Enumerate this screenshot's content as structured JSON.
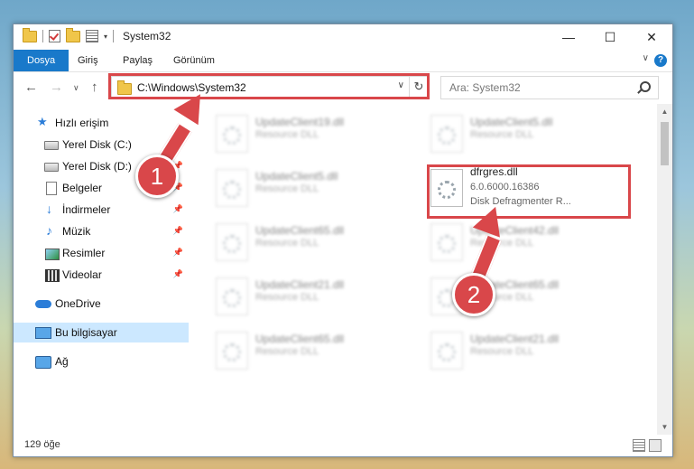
{
  "window": {
    "title": "System32",
    "controls": {
      "minimize": "—",
      "maximize": "☐",
      "close": "✕"
    }
  },
  "ribbon": {
    "tabs": [
      "Dosya",
      "Giriş",
      "Paylaş",
      "Görünüm"
    ],
    "help": "?"
  },
  "nav": {
    "back": "←",
    "forward": "→",
    "recent": "∨",
    "up": "↑",
    "address": "C:\\Windows\\System32",
    "refresh": "↻",
    "search_placeholder": "Ara: System32"
  },
  "sidebar": {
    "items": [
      {
        "label": "Hızlı erişim",
        "icon": "star-icon"
      },
      {
        "label": "Yerel Disk (C:)",
        "icon": "disk-icon",
        "pinned": true
      },
      {
        "label": "Yerel Disk (D:)",
        "icon": "disk-icon",
        "pinned": true
      },
      {
        "label": "Belgeler",
        "icon": "document-icon",
        "pinned": true
      },
      {
        "label": "İndirmeler",
        "icon": "download-icon",
        "pinned": true
      },
      {
        "label": "Müzik",
        "icon": "music-icon",
        "pinned": true
      },
      {
        "label": "Resimler",
        "icon": "pictures-icon",
        "pinned": true
      },
      {
        "label": "Videolar",
        "icon": "videos-icon",
        "pinned": true
      },
      {
        "label": "OneDrive",
        "icon": "cloud-icon"
      },
      {
        "label": "Bu bilgisayar",
        "icon": "computer-icon",
        "selected": true
      },
      {
        "label": "Ağ",
        "icon": "network-icon"
      }
    ]
  },
  "files": {
    "left": [
      {
        "name": "UpdateClient19.dll",
        "type": "Resource DLL"
      },
      {
        "name": "UpdateClient5.dll",
        "type": "Resource DLL"
      },
      {
        "name": "UpdateClient65.dll",
        "type": "Resource DLL"
      },
      {
        "name": "UpdateClient21.dll",
        "type": "Resource DLL"
      },
      {
        "name": "UpdateClient65.dll",
        "type": "Resource DLL"
      }
    ],
    "right": [
      {
        "name": "UpdateClient5.dll",
        "type": "Resource DLL"
      },
      {
        "name": "dfrgres.dll",
        "version": "6.0.6000.16386",
        "type": "Disk Defragmenter R..."
      },
      {
        "name": "UpdateClient42.dll",
        "type": "Resource DLL"
      },
      {
        "name": "UpdateClient65.dll",
        "type": "Resource DLL"
      },
      {
        "name": "UpdateClient21.dll",
        "type": "Resource DLL"
      }
    ]
  },
  "status": {
    "count": "129 öğe"
  },
  "annotations": {
    "step1": "1",
    "step2": "2"
  },
  "colors": {
    "accent": "#1979ca",
    "highlight": "#d9474a",
    "selected": "#cce8ff"
  }
}
